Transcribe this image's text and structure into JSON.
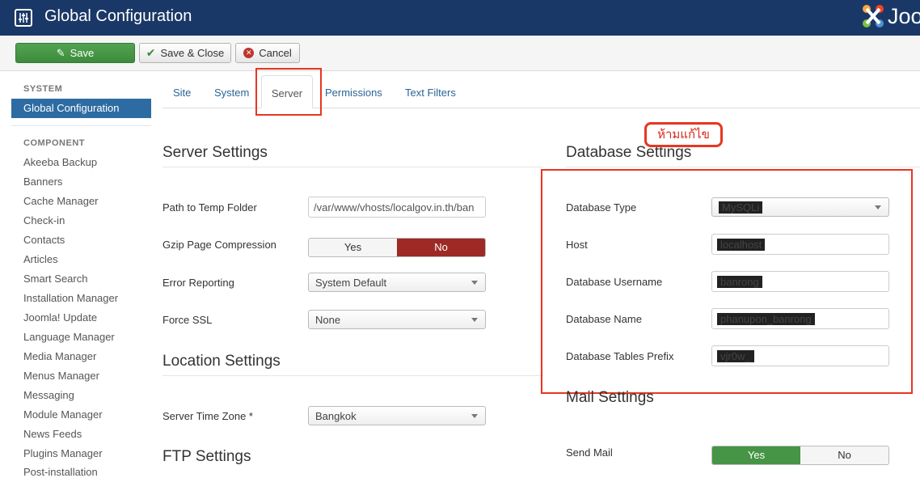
{
  "header": {
    "title": "Global Configuration",
    "logo_text": "Joo"
  },
  "toolbar": {
    "save": "Save",
    "save_close": "Save & Close",
    "cancel": "Cancel"
  },
  "sidebar": {
    "system_header": "SYSTEM",
    "active_item": "Global Configuration",
    "component_header": "COMPONENT",
    "items": [
      "Akeeba Backup",
      "Banners",
      "Cache Manager",
      "Check-in",
      "Contacts",
      "Articles",
      "Smart Search",
      "Installation Manager",
      "Joomla! Update",
      "Language Manager",
      "Media Manager",
      "Menus Manager",
      "Messaging",
      "Module Manager",
      "News Feeds",
      "Plugins Manager",
      "Post-installation"
    ]
  },
  "tabs": [
    "Site",
    "System",
    "Server",
    "Permissions",
    "Text Filters"
  ],
  "note": "ห้ามแก้ไข",
  "server": {
    "title": "Server Settings",
    "temp_label": "Path to Temp Folder",
    "temp_value": "/var/www/vhosts/localgov.in.th/ban",
    "gzip_label": "Gzip Page Compression",
    "gzip_yes": "Yes",
    "gzip_no": "No",
    "error_label": "Error Reporting",
    "error_value": "System Default",
    "ssl_label": "Force SSL",
    "ssl_value": "None"
  },
  "location": {
    "title": "Location Settings",
    "tz_label": "Server Time Zone *",
    "tz_value": "Bangkok"
  },
  "ftp": {
    "title": "FTP Settings"
  },
  "database": {
    "title": "Database Settings",
    "type_label": "Database Type",
    "type_value": "MySQLi",
    "host_label": "Host",
    "host_value": "localhost",
    "user_label": "Database Username",
    "user_value": "banrong",
    "name_label": "Database Name",
    "name_value": "phanupon_banrong",
    "prefix_label": "Database Tables Prefix",
    "prefix_value": "vjr0w_"
  },
  "mail": {
    "title": "Mail Settings",
    "send_label": "Send Mail",
    "send_yes": "Yes",
    "send_no": "No"
  }
}
